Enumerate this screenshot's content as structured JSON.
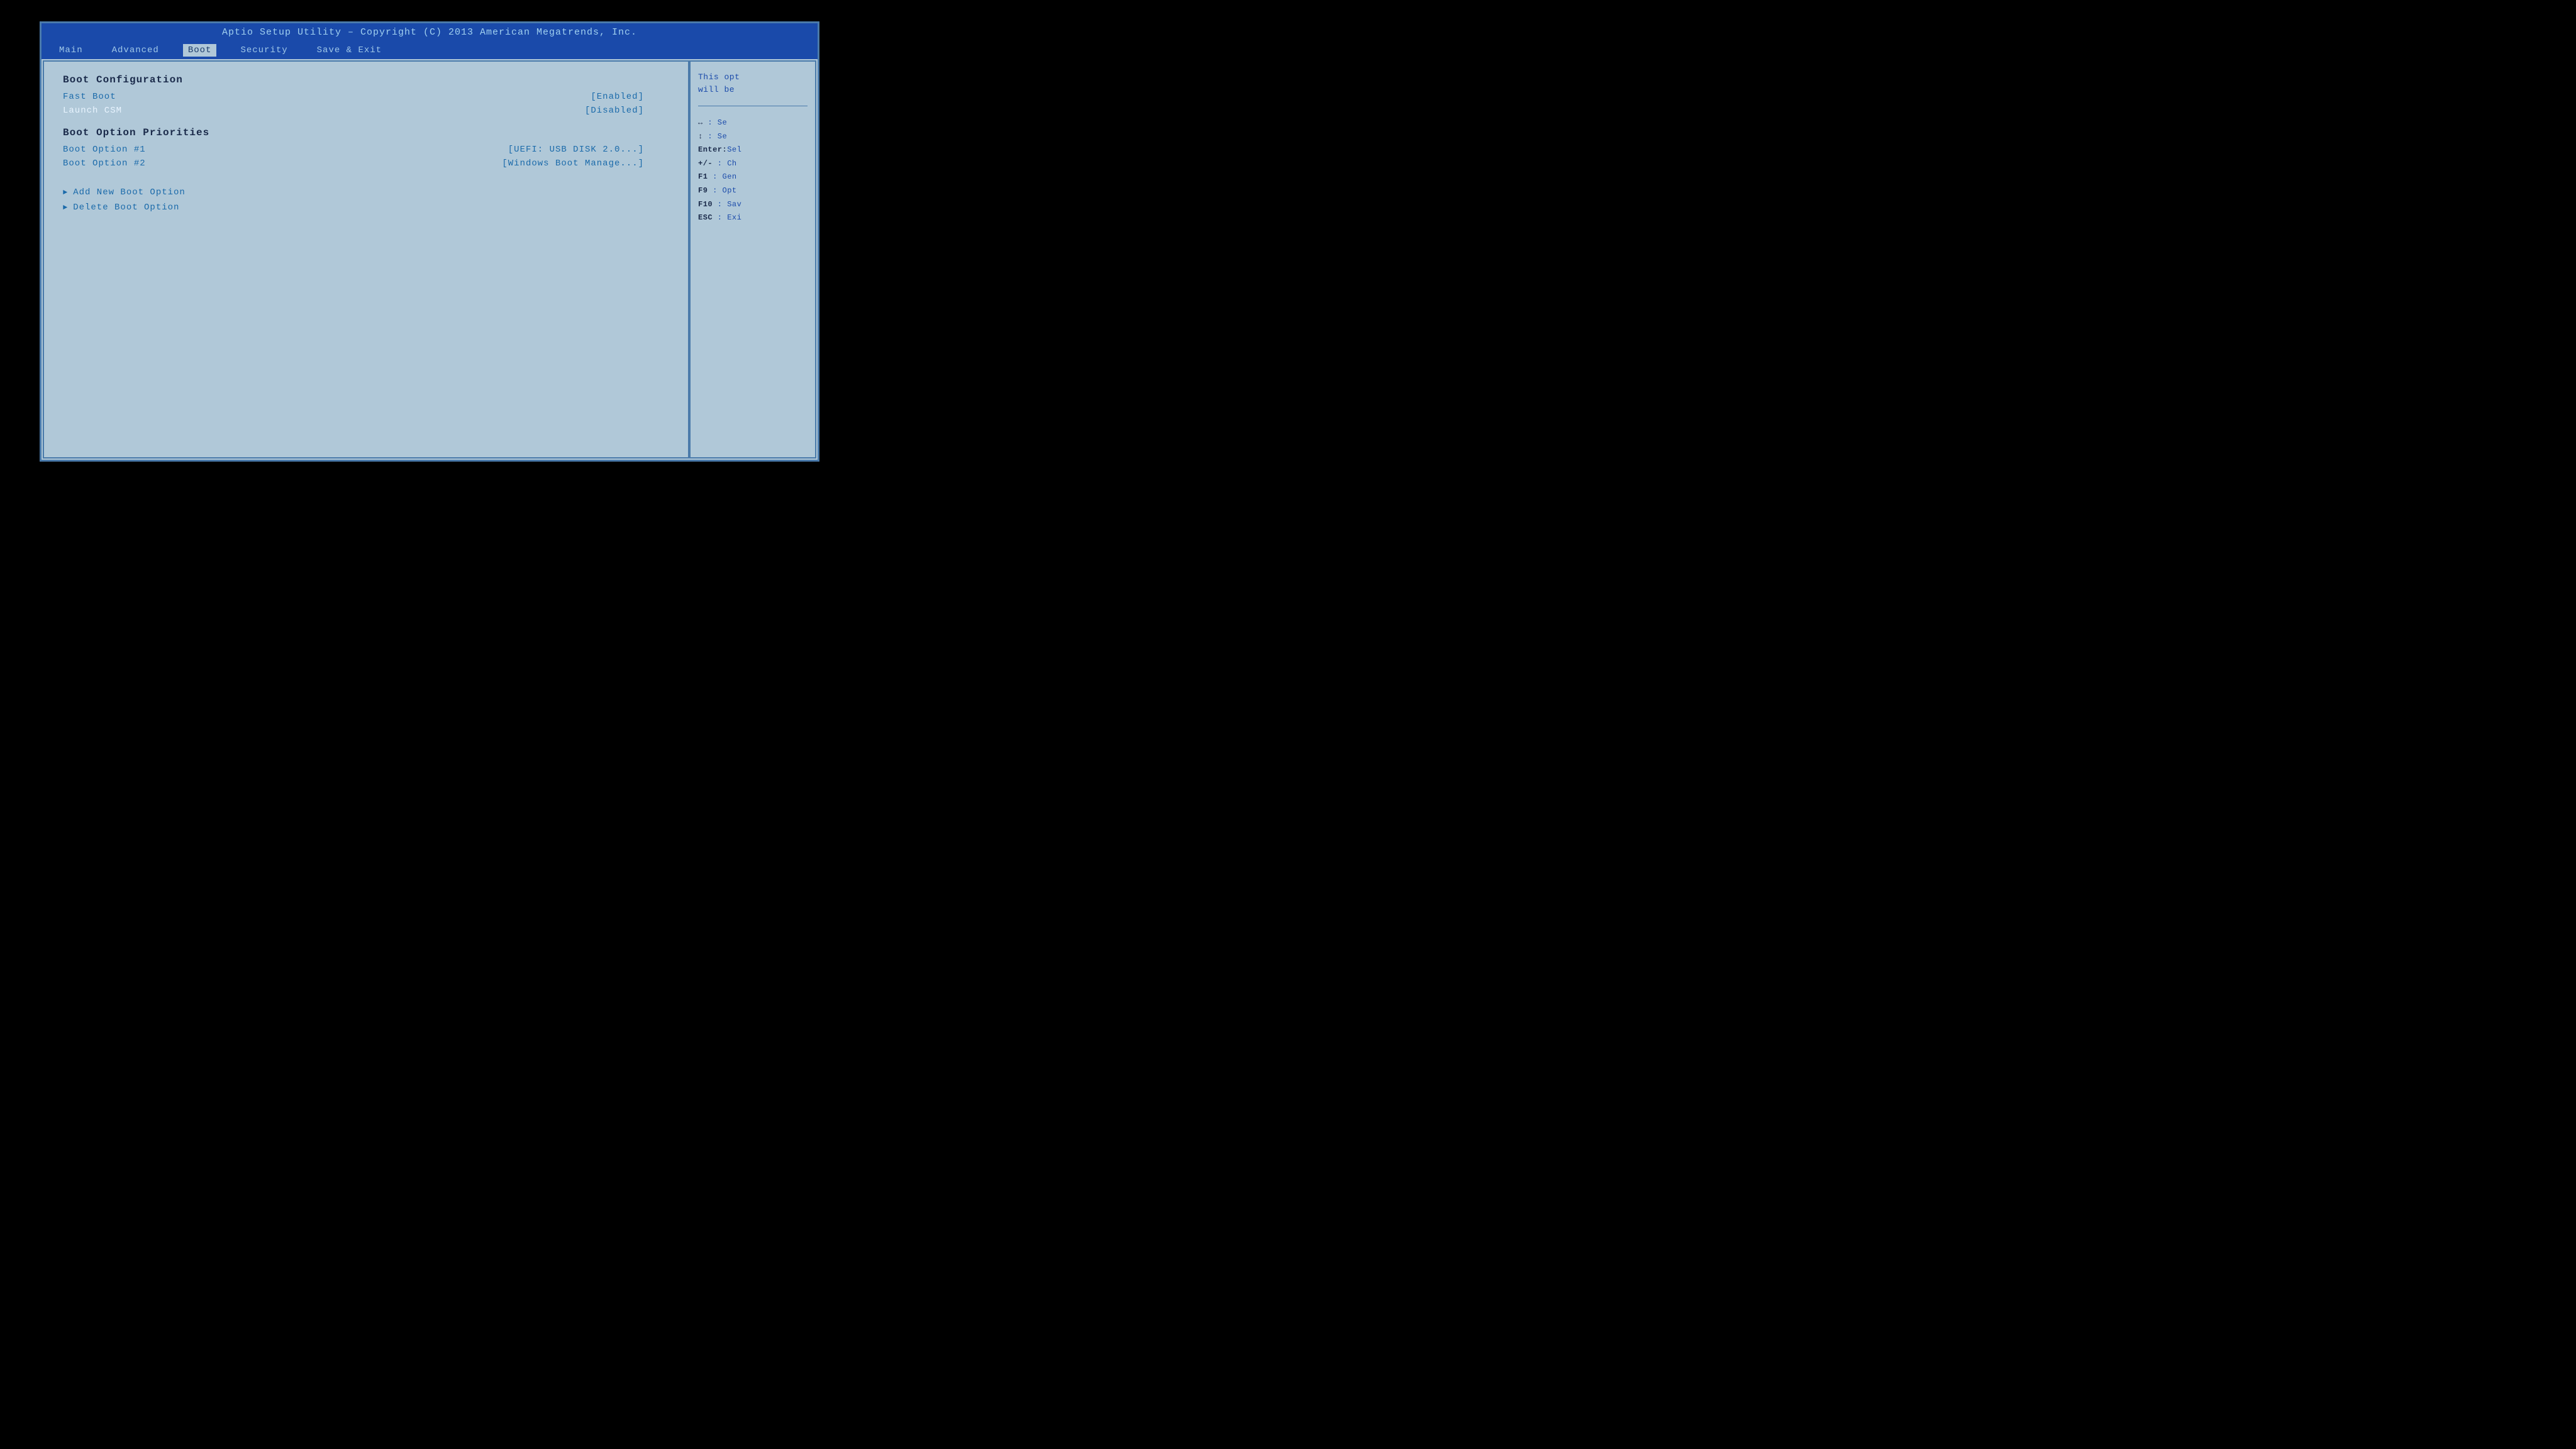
{
  "title_bar": {
    "text": "Aptio Setup Utility – Copyright (C) 2013 American Megatrends, Inc."
  },
  "menu_bar": {
    "items": [
      {
        "label": "Main",
        "active": false
      },
      {
        "label": "Advanced",
        "active": false
      },
      {
        "label": "Boot",
        "active": true
      },
      {
        "label": "Security",
        "active": false
      },
      {
        "label": "Save & Exit",
        "active": false
      }
    ]
  },
  "main_panel": {
    "boot_config_header": "Boot Configuration",
    "fast_boot_label": "Fast Boot",
    "fast_boot_value": "[Enabled]",
    "launch_csm_label": "Launch CSM",
    "launch_csm_value": "[Disabled]",
    "boot_options_header": "Boot Option Priorities",
    "boot_option1_label": "Boot Option #1",
    "boot_option1_value": "[UEFI:  USB DISK 2.0...]",
    "boot_option2_label": "Boot Option #2",
    "boot_option2_value": "[Windows Boot Manage...]",
    "add_new_boot": "Add New Boot Option",
    "delete_boot": "Delete Boot Option"
  },
  "side_panel": {
    "help_text_line1": "This opt",
    "help_text_line2": "will be",
    "key_hints": [
      {
        "key": "↔",
        "desc": "Se"
      },
      {
        "key": "↕",
        "desc": "Se"
      },
      {
        "key": "Enter:",
        "desc": "Sel"
      },
      {
        "key": "+/-",
        "desc": "Ch"
      },
      {
        "key": "F1",
        "desc": "Gen"
      },
      {
        "key": "F9",
        "desc": "Opt"
      },
      {
        "key": "F10",
        "desc": "Sav"
      },
      {
        "key": "ESC",
        "desc": "Exi"
      }
    ]
  }
}
